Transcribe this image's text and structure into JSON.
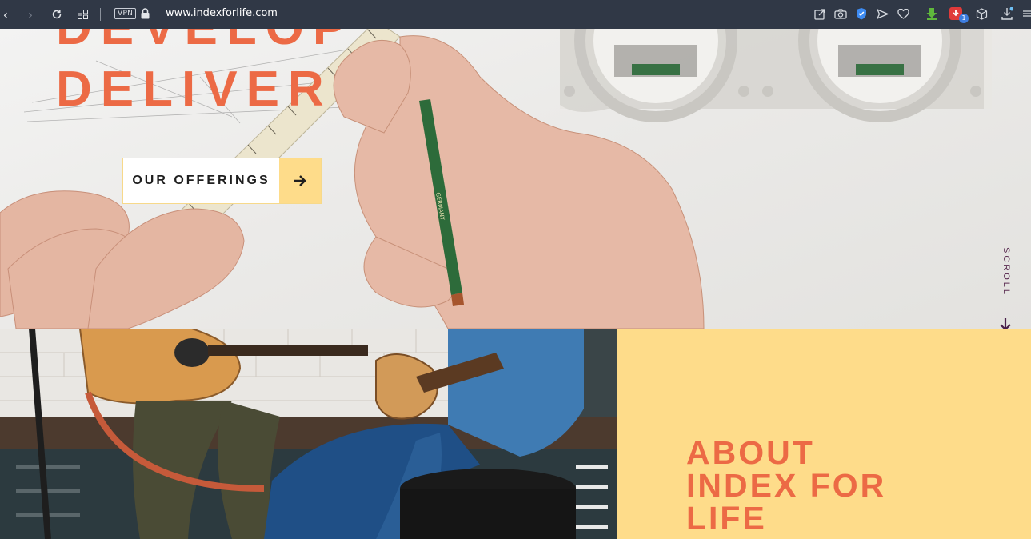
{
  "browser": {
    "vpn_label": "VPN",
    "url_host": "www.indexforlife.com",
    "notification_count": "1",
    "nav_icons": [
      "back-icon",
      "forward-icon",
      "reload-icon",
      "tabs-grid-icon"
    ],
    "toolbar_icons": [
      "share-icon",
      "camera-icon",
      "shield-icon",
      "send-icon",
      "heart-icon",
      "download-arrow-icon",
      "extension-icon",
      "box-icon",
      "downloads-icon",
      "menu-icon"
    ]
  },
  "hero": {
    "heading_top": "DEVELOP",
    "heading_main": "DELIVER",
    "offerings_label": "OUR OFFERINGS",
    "scroll_label": "SCROLL",
    "accent_color": "#ec6a45",
    "button_color": "#fedc8a"
  },
  "about": {
    "title_lines": [
      "ABOUT",
      "INDEX FOR",
      "LIFE"
    ],
    "background_color": "#fedc8a"
  }
}
